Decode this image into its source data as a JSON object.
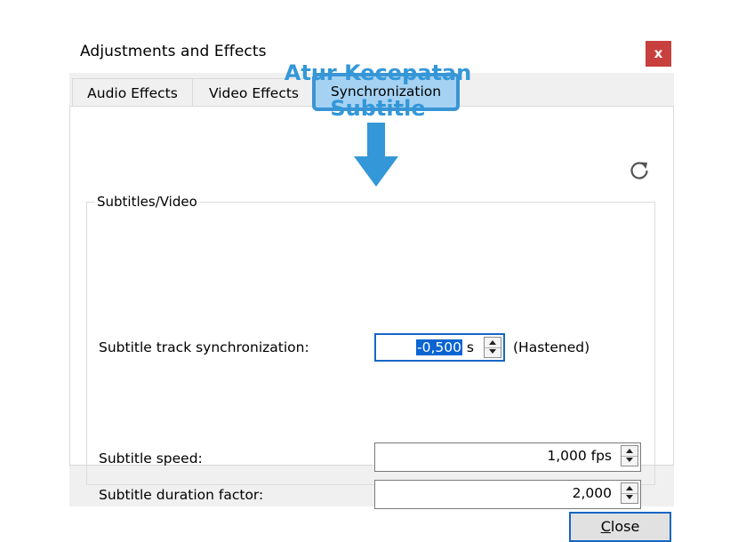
{
  "window": {
    "title": "Adjustments and Effects",
    "close_glyph": "x"
  },
  "tabs": [
    {
      "label": "Audio Effects"
    },
    {
      "label": "Video Effects"
    },
    {
      "label": "Synchronization",
      "selected": true
    }
  ],
  "annotation": {
    "line1": "Atur Kecepatan",
    "line2": "Subtitle",
    "color": "#3497d8"
  },
  "group": {
    "legend": "Subtitles/Video"
  },
  "fields": {
    "track_sync": {
      "label": "Subtitle track synchronization:",
      "value": "-0,500",
      "unit": " s",
      "status": "(Hastened)"
    },
    "speed": {
      "label": "Subtitle speed:",
      "value": "1,000 fps"
    },
    "duration": {
      "label": "Subtitle duration factor:",
      "value": "2,000"
    }
  },
  "icons": {
    "reset": "reset-icon",
    "arrow": "down-arrow-icon"
  },
  "buttons": {
    "close_first": "C",
    "close_rest": "lose"
  }
}
